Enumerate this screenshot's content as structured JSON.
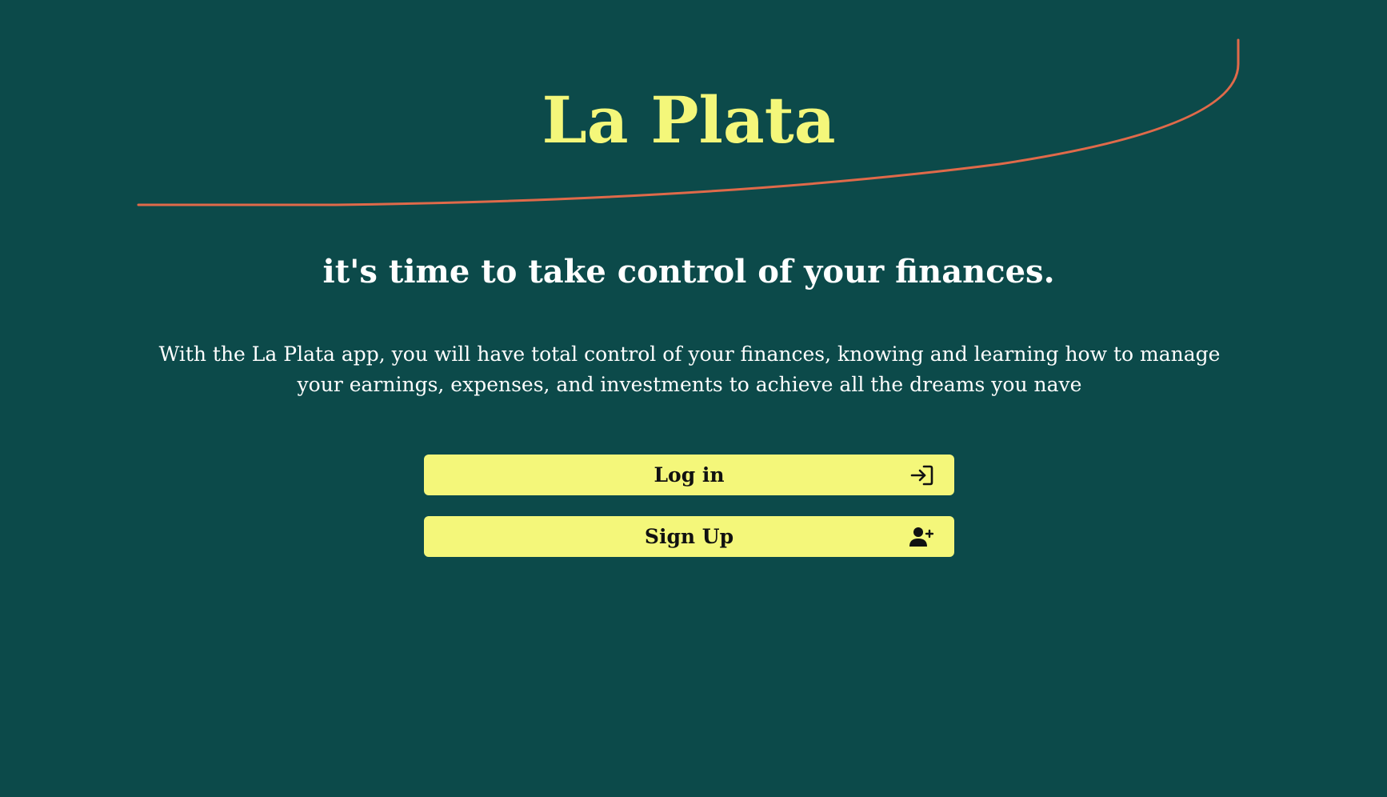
{
  "brand": {
    "title": "La Plata"
  },
  "hero": {
    "tagline": "it's time to take control of your finances.",
    "description": "With the La Plata app, you will have total control of your finances, knowing and learning how to manage your earnings, expenses, and investments to achieve all the dreams you nave"
  },
  "actions": {
    "login": {
      "label": "Log in",
      "icon": "log-in-icon"
    },
    "signup": {
      "label": "Sign Up",
      "icon": "user-plus-icon"
    }
  },
  "colors": {
    "background": "#0c4a4a",
    "brand": "#f4f77a",
    "accent_line": "#e06a4a",
    "button_bg": "#f4f77a",
    "text_light": "#ffffff"
  }
}
